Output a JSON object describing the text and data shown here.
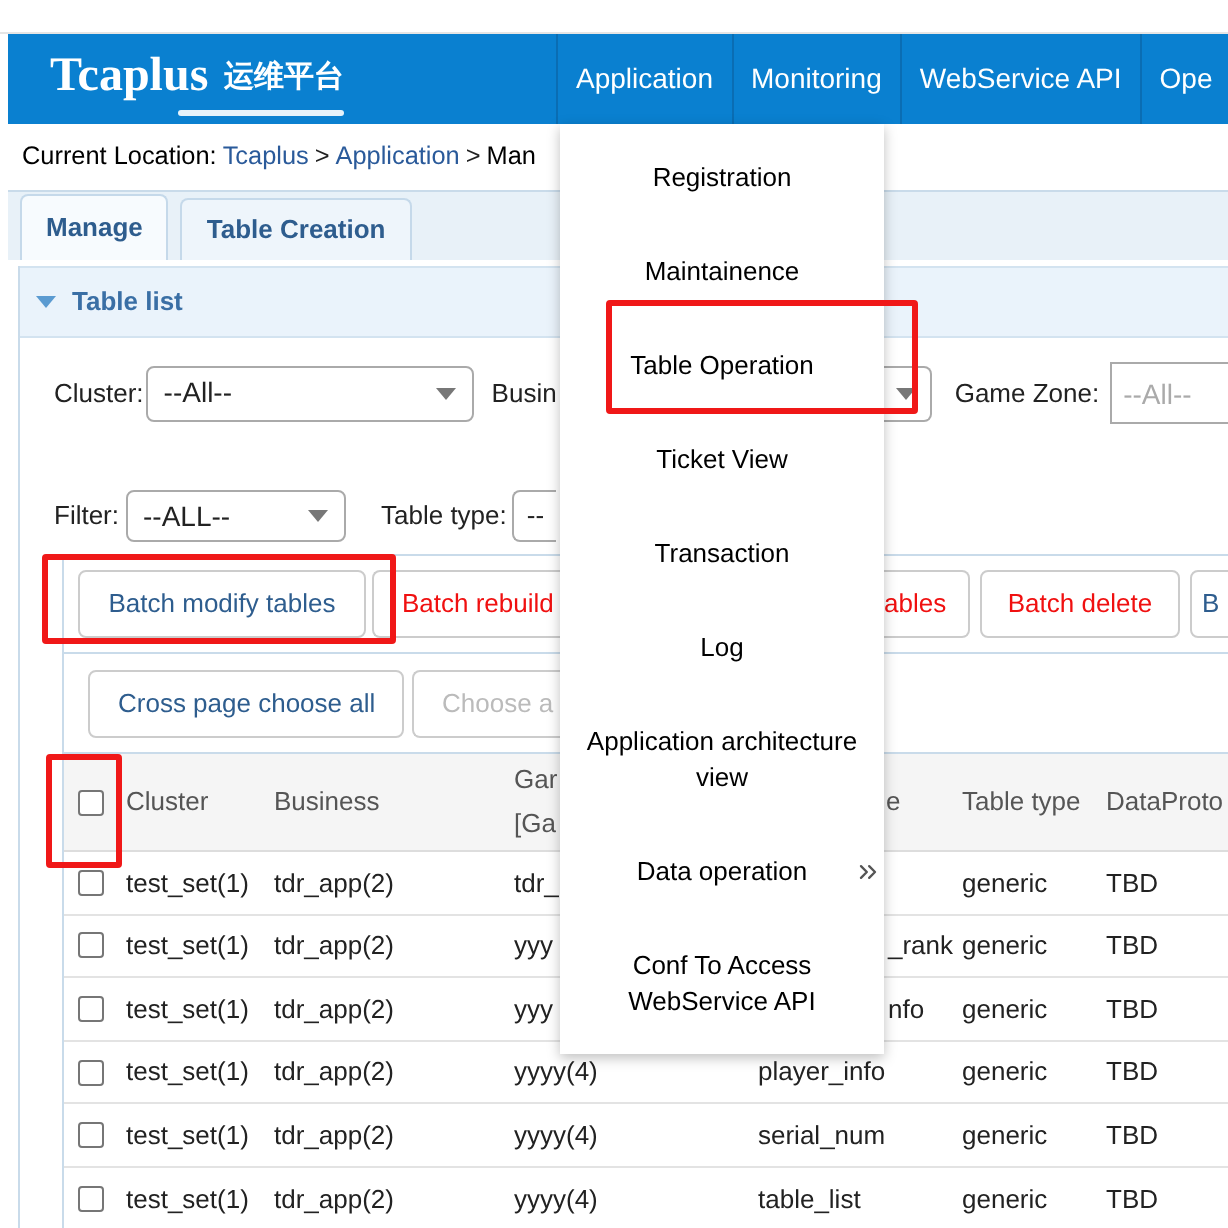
{
  "header": {
    "logo": "Tcaplus",
    "logo_cn": "运维平台",
    "nav": [
      {
        "label": "Application"
      },
      {
        "label": "Monitoring"
      },
      {
        "label": "WebService API"
      },
      {
        "label": "Ope"
      }
    ]
  },
  "breadcrumb": [
    {
      "kind": "label",
      "text": "Current Location:"
    },
    {
      "kind": "link",
      "text": "Tcaplus"
    },
    {
      "kind": "sep",
      "text": ">"
    },
    {
      "kind": "link",
      "text": "Application"
    },
    {
      "kind": "sep",
      "text": ">"
    },
    {
      "kind": "current",
      "text": "Man"
    }
  ],
  "tabs": [
    {
      "label": "Manage",
      "selected": true
    },
    {
      "label": "Table Creation",
      "selected": false
    }
  ],
  "panel": {
    "title": "Table list",
    "expanded": true
  },
  "filters": {
    "cluster": {
      "label": "Cluster:",
      "value": "--All--"
    },
    "business": {
      "label": "Busin"
    },
    "game_zone": {
      "label": "Game Zone:",
      "placeholder": "--All--"
    },
    "filter": {
      "label": "Filter:",
      "value": "--ALL--"
    },
    "table_type": {
      "label": "Table type:",
      "value": "--"
    }
  },
  "actions": [
    {
      "label": "Batch modify tables",
      "kind": "normal",
      "highlighted": true,
      "clipped": false
    },
    {
      "label": "Batch rebuild",
      "kind": "danger",
      "highlighted": false,
      "clipped": false
    },
    {
      "label": "ables",
      "kind": "danger",
      "highlighted": false,
      "clipped": true
    },
    {
      "label": "Batch delete",
      "kind": "danger",
      "highlighted": false,
      "clipped": false
    },
    {
      "label": "B",
      "kind": "normal",
      "highlighted": false,
      "clipped": false
    }
  ],
  "selection_buttons": [
    {
      "label": "Cross page choose all",
      "disabled": false
    },
    {
      "label": "Choose a",
      "disabled": true
    }
  ],
  "table": {
    "header_checkbox": {
      "checked": false,
      "highlighted": true
    },
    "columns": [
      {
        "lines": [
          "Cluster"
        ],
        "clipped": false
      },
      {
        "lines": [
          "Business"
        ],
        "clipped": false
      },
      {
        "lines": [
          "Gar",
          "[Ga"
        ],
        "clipped": false
      },
      {
        "lines": [
          "e"
        ],
        "clipped": true
      },
      {
        "lines": [
          "Table type"
        ],
        "clipped": false
      },
      {
        "lines": [
          "DataProto"
        ],
        "clipped": false
      }
    ],
    "rows": [
      {
        "checked": false,
        "cluster": "test_set(1)",
        "business": "tdr_app(2)",
        "game_zone": "tdr_",
        "table_name_clipped": false,
        "table_type": "generic",
        "data_protocol": "TBD"
      },
      {
        "checked": false,
        "cluster": "test_set(1)",
        "business": "tdr_app(2)",
        "game_zone": "yyy",
        "table_name": "_rank",
        "table_name_clipped": true,
        "table_type": "generic",
        "data_protocol": "TBD"
      },
      {
        "checked": false,
        "cluster": "test_set(1)",
        "business": "tdr_app(2)",
        "game_zone": "yyy",
        "table_name": "nfo",
        "table_name_clipped": true,
        "table_type": "generic",
        "data_protocol": "TBD"
      },
      {
        "checked": false,
        "cluster": "test_set(1)",
        "business": "tdr_app(2)",
        "game_zone": "yyyy(4)",
        "table_name": "player_info",
        "table_name_clipped": false,
        "table_type": "generic",
        "data_protocol": "TBD"
      },
      {
        "checked": false,
        "cluster": "test_set(1)",
        "business": "tdr_app(2)",
        "game_zone": "yyyy(4)",
        "table_name": "serial_num",
        "table_name_clipped": false,
        "table_type": "generic",
        "data_protocol": "TBD"
      },
      {
        "checked": false,
        "cluster": "test_set(1)",
        "business": "tdr_app(2)",
        "game_zone": "yyyy(4)",
        "table_name": "table_list",
        "table_name_clipped": false,
        "table_type": "generic",
        "data_protocol": "TBD"
      }
    ]
  },
  "menu": {
    "items": [
      {
        "label": "Registration",
        "highlighted": false,
        "has_submenu": false
      },
      {
        "label": "Maintainence",
        "highlighted": false,
        "has_submenu": false
      },
      {
        "label": "Table Operation",
        "highlighted": true,
        "has_submenu": false
      },
      {
        "label": "Ticket View",
        "highlighted": false,
        "has_submenu": false
      },
      {
        "label": "Transaction",
        "highlighted": false,
        "has_submenu": false
      },
      {
        "label": "Log",
        "highlighted": false,
        "has_submenu": false
      },
      {
        "label": "Application architecture view",
        "highlighted": false,
        "has_submenu": false
      },
      {
        "label": "Data operation",
        "highlighted": false,
        "has_submenu": true
      },
      {
        "label": "Conf To Access WebService API",
        "highlighted": false,
        "has_submenu": false
      }
    ]
  }
}
